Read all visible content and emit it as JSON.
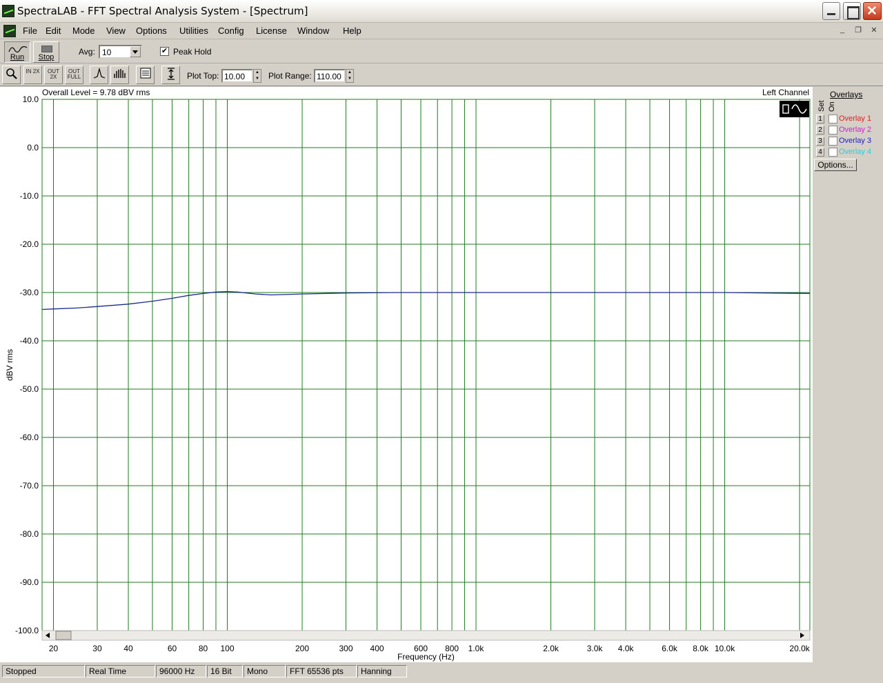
{
  "window": {
    "title": "SpectraLAB - FFT Spectral Analysis System - [Spectrum]"
  },
  "menu": [
    "File",
    "Edit",
    "Mode",
    "View",
    "Options",
    "Utilities",
    "Config",
    "License",
    "Window",
    "Help"
  ],
  "toolbar": {
    "run_label": "Run",
    "stop_label": "Stop",
    "avg_label": "Avg:",
    "avg_value": "10",
    "peak_hold_label": "Peak Hold",
    "peak_hold_checked": true,
    "zoom_buttons": [
      "IN 2X",
      "OUT 2X",
      "OUT FULL"
    ],
    "plot_top_label": "Plot Top:",
    "plot_top_value": "10.00",
    "plot_range_label": "Plot Range:",
    "plot_range_value": "110.00"
  },
  "plot": {
    "overall_level": "Overall Level = 9.78 dBV rms",
    "channel": "Left Channel"
  },
  "overlays": {
    "title": "Overlays",
    "set_label": "Set",
    "on_label": "On",
    "items": [
      {
        "num": "1",
        "label": "Overlay 1",
        "color": "#e02020"
      },
      {
        "num": "2",
        "label": "Overlay 2",
        "color": "#d020d0"
      },
      {
        "num": "3",
        "label": "Overlay 3",
        "color": "#2020c0"
      },
      {
        "num": "4",
        "label": "Overlay 4",
        "color": "#20d0e0"
      }
    ],
    "options_label": "Options..."
  },
  "status": [
    "Stopped",
    "Real Time",
    "96000 Hz",
    "16 Bit",
    "Mono",
    "FFT 65536 pts",
    "Hanning"
  ],
  "chart_data": {
    "type": "line",
    "xlabel": "Frequency (Hz)",
    "ylabel": "dBV rms",
    "xscale": "log",
    "xlim": [
      18,
      22000
    ],
    "ylim": [
      -100,
      10
    ],
    "yticks": [
      "10.0",
      "0.0",
      "-10.0",
      "-20.0",
      "-30.0",
      "-40.0",
      "-50.0",
      "-60.0",
      "-70.0",
      "-80.0",
      "-90.0",
      "-100.0"
    ],
    "xticks": [
      {
        "v": 20,
        "label": "20"
      },
      {
        "v": 30,
        "label": "30"
      },
      {
        "v": 40,
        "label": "40"
      },
      {
        "v": 60,
        "label": "60"
      },
      {
        "v": 80,
        "label": "80"
      },
      {
        "v": 100,
        "label": "100"
      },
      {
        "v": 200,
        "label": "200"
      },
      {
        "v": 300,
        "label": "300"
      },
      {
        "v": 400,
        "label": "400"
      },
      {
        "v": 600,
        "label": "600"
      },
      {
        "v": 800,
        "label": "800"
      },
      {
        "v": 1000,
        "label": "1.0k"
      },
      {
        "v": 2000,
        "label": "2.0k"
      },
      {
        "v": 3000,
        "label": "3.0k"
      },
      {
        "v": 4000,
        "label": "4.0k"
      },
      {
        "v": 6000,
        "label": "6.0k"
      },
      {
        "v": 8000,
        "label": "8.0k"
      },
      {
        "v": 10000,
        "label": "10.0k"
      },
      {
        "v": 20000,
        "label": "20.0k"
      }
    ],
    "grid_x": [
      20,
      30,
      40,
      50,
      60,
      70,
      80,
      90,
      100,
      200,
      300,
      400,
      500,
      600,
      700,
      800,
      900,
      1000,
      2000,
      3000,
      4000,
      5000,
      6000,
      7000,
      8000,
      9000,
      10000,
      20000
    ],
    "grid": true,
    "series": [
      {
        "color": "#1a2a8a",
        "x": [
          18,
          20,
          25,
          30,
          40,
          50,
          60,
          70,
          80,
          90,
          100,
          110,
          130,
          150,
          200,
          300,
          500,
          1000,
          2000,
          3000,
          5000,
          10000,
          15000,
          22000
        ],
        "y": [
          -33.5,
          -33.4,
          -33.2,
          -32.9,
          -32.4,
          -31.8,
          -31.2,
          -30.6,
          -30.2,
          -29.9,
          -29.8,
          -29.9,
          -30.3,
          -30.5,
          -30.3,
          -30.1,
          -30.0,
          -30.0,
          -30.0,
          -30.0,
          -30.0,
          -30.0,
          -30.1,
          -30.2
        ]
      }
    ]
  }
}
